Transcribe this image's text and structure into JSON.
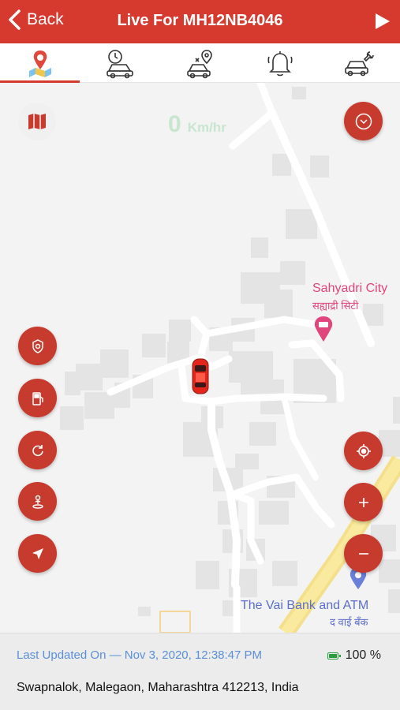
{
  "header": {
    "back_label": "Back",
    "title": "Live For MH12NB4046",
    "accent_color": "#d63a2f"
  },
  "tabs": [
    {
      "name": "live-map",
      "icon": "map-pin-icon",
      "active": true
    },
    {
      "name": "trip-history",
      "icon": "car-clock-icon",
      "active": false
    },
    {
      "name": "car-location",
      "icon": "car-location-icon",
      "active": false
    },
    {
      "name": "alerts",
      "icon": "bell-icon",
      "active": false
    },
    {
      "name": "service",
      "icon": "car-wrench-icon",
      "active": false
    }
  ],
  "map": {
    "speed_value": "0",
    "speed_unit": "Km/hr",
    "labels": {
      "sahyadri_en": "Sahyadri City",
      "sahyadri_hi": "सह्याद्री सिटी",
      "bank_en": "The Vai Bank and ATM",
      "bank_hi": "द वाई बँक"
    },
    "controls": [
      "map-type",
      "collapse",
      "police",
      "fuel",
      "refresh",
      "person",
      "navigate",
      "recenter",
      "zoom-in",
      "zoom-out"
    ]
  },
  "footer": {
    "last_updated": "Last Updated On — Nov 3, 2020, 12:38:47 PM",
    "battery": "100 %",
    "address": "Swapnalok, Malegaon, Maharashtra 412213, India"
  }
}
